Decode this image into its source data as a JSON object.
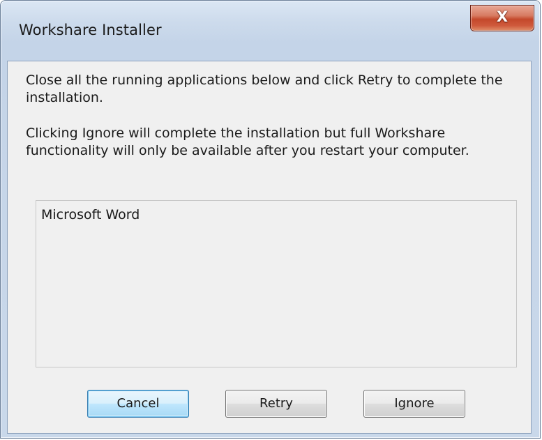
{
  "window": {
    "title": "Workshare Installer",
    "close_label": "X"
  },
  "content": {
    "message_1": "Close all the running applications below and click Retry to complete the installation.",
    "message_2": "Clicking Ignore will complete the installation but full Workshare functionality will only be available after you restart your computer.",
    "applications": [
      "Microsoft Word"
    ]
  },
  "buttons": {
    "cancel": "Cancel",
    "retry": "Retry",
    "ignore": "Ignore"
  },
  "colors": {
    "close_button": "#c4482b",
    "default_button_border": "#3c7fb1",
    "client_background": "#f0f0f0"
  }
}
